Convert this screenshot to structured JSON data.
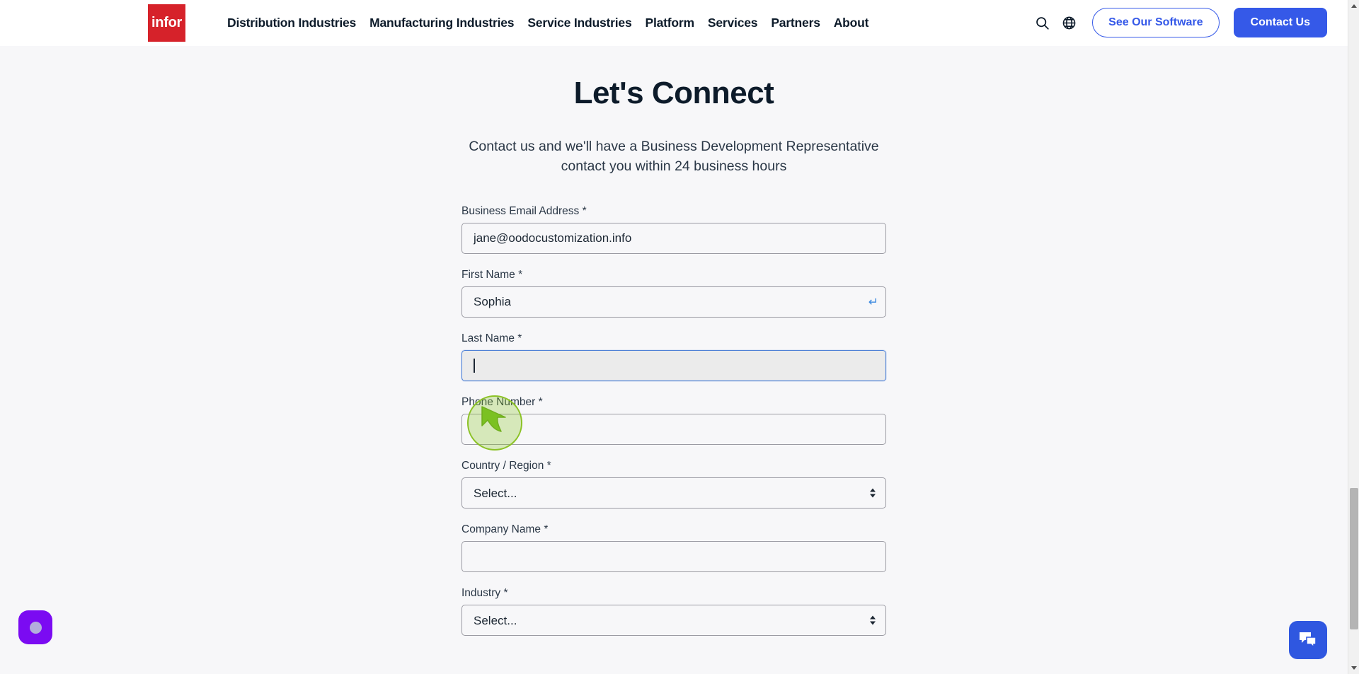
{
  "brand": {
    "logo_text": "infor",
    "logo_color": "#D6222A",
    "accent_blue": "#3559E8"
  },
  "nav": {
    "items": [
      {
        "label": "Distribution Industries"
      },
      {
        "label": "Manufacturing Industries"
      },
      {
        "label": "Service Industries"
      },
      {
        "label": "Platform"
      },
      {
        "label": "Services"
      },
      {
        "label": "Partners"
      },
      {
        "label": "About"
      }
    ],
    "search_icon": "search-icon",
    "language_icon": "globe-icon",
    "secondary_button": "See Our Software",
    "primary_button": "Contact Us"
  },
  "hero": {
    "title": "Let's Connect",
    "subtitle": "Contact us and we'll have a Business Development Representative contact you within 24 business hours"
  },
  "form": {
    "fields": [
      {
        "name": "business-email",
        "label": "Business Email Address",
        "required_marker": "*",
        "type": "text",
        "value": "jane@oodocustomization.info",
        "placeholder": ""
      },
      {
        "name": "first-name",
        "label": "First Name",
        "required_marker": "*",
        "type": "text",
        "value": "Sophia",
        "placeholder": "",
        "trailing_icon": "return-arrow-icon",
        "trailing_icon_glyph": "↵"
      },
      {
        "name": "last-name",
        "label": "Last Name",
        "required_marker": "*",
        "type": "text",
        "value": "",
        "placeholder": "",
        "focused": true
      },
      {
        "name": "phone-number",
        "label": "Phone Number",
        "required_marker": "*",
        "type": "text",
        "value": "",
        "placeholder": ""
      },
      {
        "name": "country-region",
        "label": "Country / Region",
        "required_marker": "*",
        "type": "select",
        "value": "Select...",
        "options": [
          "Select..."
        ]
      },
      {
        "name": "company-name",
        "label": "Company Name",
        "required_marker": "*",
        "type": "text",
        "value": "",
        "placeholder": ""
      },
      {
        "name": "industry",
        "label": "Industry",
        "required_marker": "*",
        "type": "select",
        "value": "Select...",
        "options": [
          "Select..."
        ]
      }
    ]
  },
  "overlay": {
    "cursor_indicator": "click-highlight-circle",
    "cursor_icon": "mouse-pointer-arrow-icon",
    "color": "#8BC225"
  },
  "widgets": {
    "bottom_left": {
      "name": "accessibility-widget",
      "color": "#7B0BF2"
    },
    "bottom_right": {
      "name": "chat-widget",
      "icon": "chat-bubbles-icon",
      "color": "#2F57E0"
    }
  },
  "scrollbar": {
    "up_arrow": "scroll-up-arrow",
    "down_arrow": "scroll-down-arrow",
    "thumb": "scroll-thumb"
  }
}
